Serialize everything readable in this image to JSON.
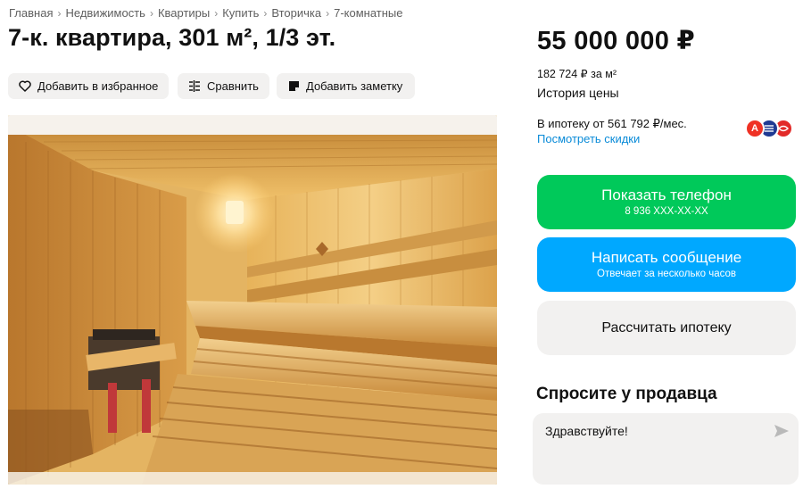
{
  "breadcrumbs": [
    "Главная",
    "Недвижимость",
    "Квартиры",
    "Купить",
    "Вторичка",
    "7-комнатные"
  ],
  "listing": {
    "title": "7-к. квартира, 301 м², 1/3 эт."
  },
  "actions": {
    "favorite_label": "Добавить в избранное",
    "favorite_icon": "heart-icon",
    "compare_label": "Сравнить",
    "compare_icon": "compare-icon",
    "note_label": "Добавить заметку",
    "note_icon": "note-icon"
  },
  "photo": {
    "subject": "wooden sauna interior"
  },
  "pricing": {
    "price": "55 000 000 ₽",
    "per_square_meter": "182 724 ₽ за м²",
    "history_link": "История цены",
    "mortgage_from": "В ипотеку от 561 792 ₽/мес.",
    "discounts_link": "Посмотреть скидки",
    "bank_icons": [
      "alfa-bank-icon",
      "bank-icon",
      "sovcombank-icon"
    ],
    "bank_badge_letter": "А"
  },
  "contact": {
    "phone_button": "Показать телефон",
    "phone_masked": "8 936 XXX-XX-XX",
    "message_button": "Написать сообщение",
    "message_sub": "Отвечает за несколько часов",
    "mortgage_button": "Рассчитать ипотеку"
  },
  "ask_seller": {
    "title": "Спросите у продавца",
    "message": "Здравствуйте!"
  },
  "colors": {
    "green": "#00c95a",
    "blue": "#00a8ff",
    "link": "#0a8bd8",
    "button_bg": "#f2f1f0"
  }
}
